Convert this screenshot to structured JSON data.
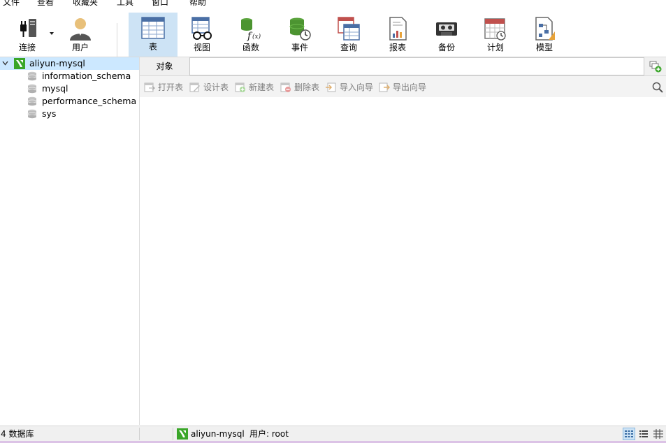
{
  "menu": [
    "文件",
    "查看",
    "收藏夹",
    "工具",
    "窗口",
    "帮助"
  ],
  "toolbar": {
    "connect": "连接",
    "user": "用户",
    "table": "表",
    "view": "视图",
    "function": "函数",
    "event": "事件",
    "query": "查询",
    "report": "报表",
    "backup": "备份",
    "schedule": "计划",
    "model": "模型"
  },
  "tree": {
    "connection": "aliyun-mysql",
    "databases": [
      "information_schema",
      "mysql",
      "performance_schema",
      "sys"
    ]
  },
  "objects": {
    "tab_label": "对象",
    "actions": [
      "打开表",
      "设计表",
      "新建表",
      "删除表",
      "导入向导",
      "导出向导"
    ]
  },
  "status": {
    "db_count": "4 数据库",
    "connection": "aliyun-mysql",
    "user": "用户: root"
  },
  "colors": {
    "accent_selected": "#cde3f5",
    "tree_selected": "#cce8ff",
    "navicat_green": "#3aa629"
  }
}
